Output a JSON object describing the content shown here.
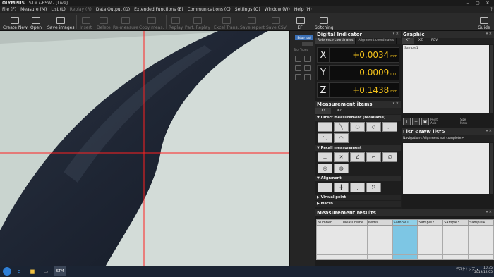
{
  "titlebar": {
    "brand": "OLYMPUS",
    "title": "STM7-BSW - [Live]"
  },
  "menu": {
    "items": [
      {
        "label": "File (F)",
        "dim": false
      },
      {
        "label": "Measure (M)",
        "dim": false
      },
      {
        "label": "List (L)",
        "dim": false
      },
      {
        "label": "Replay (R)",
        "dim": true
      },
      {
        "label": "Data Output (D)",
        "dim": false
      },
      {
        "label": "Extended Functions (E)",
        "dim": false
      },
      {
        "label": "Communications (C)",
        "dim": false
      },
      {
        "label": "Settings (O)",
        "dim": false
      },
      {
        "label": "Window (W)",
        "dim": false
      },
      {
        "label": "Help (H)",
        "dim": false
      }
    ]
  },
  "toolbar": {
    "create_new": "Create New",
    "open": "Open",
    "save_images": "Save images",
    "insert": "Insert",
    "delete": "Delete",
    "remeasure": "Re-measure",
    "copy_meas": "Copy meas.",
    "replay": "Replay",
    "part_replay": "Part. Replay",
    "excel_trans": "Excel Trans.",
    "save_report": "Save report",
    "save_csv": "Save CSV",
    "efi": "EFI",
    "stitching": "Stitching",
    "guide": "Guide"
  },
  "toolstrip": {
    "tab": "Edge tool",
    "label": "Tool Types"
  },
  "digital": {
    "title": "Digital Indicator",
    "tab_ref": "Reference coordinates",
    "tab_align": "Alignment coordinates",
    "x_label": "X",
    "x_value": "+0.0034",
    "y_label": "Y",
    "y_value": "-0.0009",
    "z_label": "Z",
    "z_value": "+0.1438",
    "unit": "mm"
  },
  "meas_items": {
    "title": "Measurement items",
    "tab_xy": "XY",
    "tab_xz": "XZ",
    "direct": "Direct measurement (recallable)",
    "recall": "Recall measurement",
    "alignment": "Alignment",
    "virtual": "Virtual point",
    "macro": "Macro"
  },
  "graphic": {
    "title": "Graphic",
    "tab_xy": "XY",
    "tab_xz": "XZ",
    "tab_fov": "FOV",
    "sample": "Sample1",
    "point": "Point",
    "axis": "Axis",
    "size": "Size",
    "mask": "Mask"
  },
  "list": {
    "title": "List <New list>",
    "navigation": "Navigation<Alignment not complete>"
  },
  "results": {
    "title": "Measurement results",
    "columns": [
      "Number",
      "Measureme",
      "Items",
      "Sample1",
      "Sample2",
      "Sample3",
      "Sample4"
    ]
  },
  "taskbar": {
    "app": "STM",
    "desktop": "デスクトップ",
    "time": "10:35",
    "date": "2019/12/05"
  },
  "colors": {
    "accent": "#3a6fb5",
    "readout": "#f3c21b",
    "crosshair": "#ff2020"
  }
}
